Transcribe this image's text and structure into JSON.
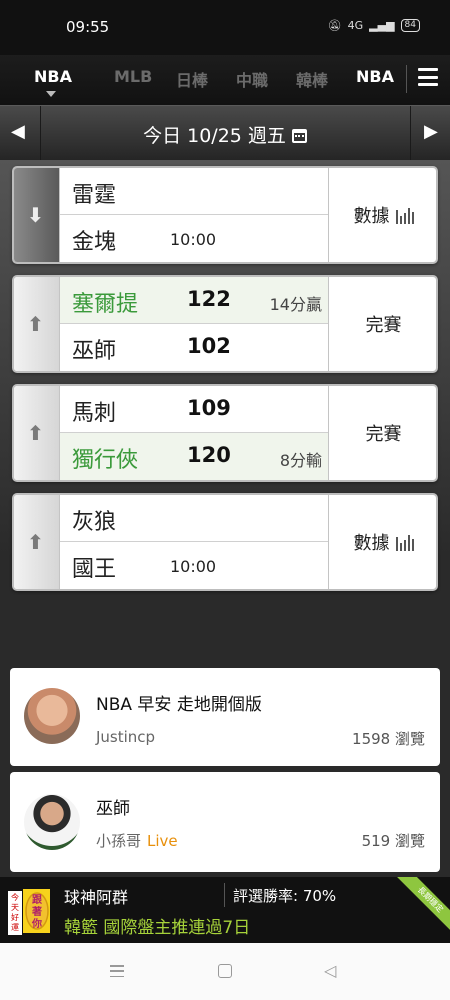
{
  "status_bar": {
    "time": "09:55",
    "network": "4G",
    "battery": "84"
  },
  "tabs": [
    {
      "label": "NBA",
      "active": true
    },
    {
      "label": "MLB",
      "active": false
    },
    {
      "label": "日棒",
      "active": false
    },
    {
      "label": "中職",
      "active": false
    },
    {
      "label": "韓棒",
      "active": false
    },
    {
      "label": "NBA",
      "active": false
    }
  ],
  "date_bar": {
    "label": "今日 10/25 週五",
    "prev_glyph": "◀",
    "next_glyph": "▶"
  },
  "games": [
    {
      "team1": {
        "name": "雷霆",
        "score": "",
        "win": false
      },
      "team2": {
        "name": "金塊",
        "score": "",
        "time": "10:00",
        "win": false
      },
      "margin": "",
      "status": "數據",
      "expanded": true
    },
    {
      "team1": {
        "name": "塞爾提",
        "score": "122",
        "win": true
      },
      "team2": {
        "name": "巫師",
        "score": "102",
        "win": false
      },
      "margin": "14分贏",
      "status": "完賽",
      "expanded": false
    },
    {
      "team1": {
        "name": "馬刺",
        "score": "109",
        "win": false
      },
      "team2": {
        "name": "獨行俠",
        "score": "120",
        "win": true
      },
      "margin": "8分輸",
      "status": "完賽",
      "expanded": false
    },
    {
      "team1": {
        "name": "灰狼",
        "score": "",
        "win": false
      },
      "team2": {
        "name": "國王",
        "score": "",
        "time": "10:00",
        "win": false
      },
      "margin": "",
      "status": "數據",
      "expanded": false
    }
  ],
  "posts": [
    {
      "title": "NBA 早安 走地開個版",
      "author": "Justincp",
      "live": "",
      "views": "1598 瀏覽"
    },
    {
      "title": "巫師",
      "author": "小孫哥",
      "live": "Live",
      "views": "519 瀏覽"
    }
  ],
  "banner": {
    "expert": "球神阿群",
    "rate": "評選勝率: 70%",
    "pick": "韓籃 國際盤主推連過7日",
    "ribbon": "長期穩定",
    "logo_text": [
      "今",
      "天",
      "好",
      "運",
      "跟",
      "著",
      "你"
    ]
  },
  "colors": {
    "win_green": "#3b9a3b",
    "live_orange": "#e8900c",
    "banner_green": "#a6d23a"
  }
}
